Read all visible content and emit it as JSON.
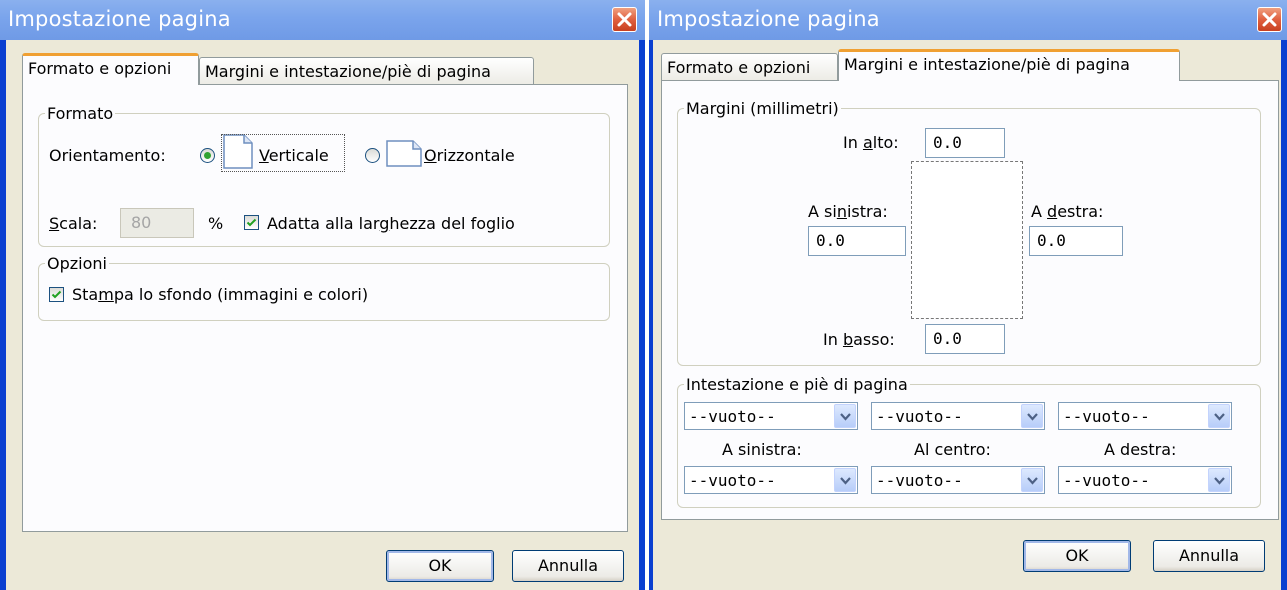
{
  "dialog_title": "Impostazione pagina",
  "tabs": {
    "format": "Formato e opzioni",
    "margins": "Margini e intestazione/piè di pagina"
  },
  "format_tab": {
    "format_group": "Formato",
    "orientation_label": "Orientamento:",
    "portrait": {
      "pre": "",
      "key": "V",
      "post": "erticale",
      "selected": true
    },
    "landscape": {
      "pre": "",
      "key": "O",
      "post": "rizzontale",
      "selected": false
    },
    "scale": {
      "pre": "",
      "key": "S",
      "post": "cala:",
      "value": "80",
      "unit": "%"
    },
    "shrink_to_fit": {
      "pre": "Adatta alla lar",
      "key": "g",
      "post": "hezza del foglio",
      "checked": true
    },
    "options_group": "Opzioni",
    "print_background": {
      "pre": "Sta",
      "key": "m",
      "post": "pa lo sfondo (immagini e colori)",
      "checked": true
    }
  },
  "margins_tab": {
    "margins_group": "Margini (millimetri)",
    "top": {
      "pre": "In ",
      "key": "a",
      "post": "lto:",
      "value": "0.0"
    },
    "left": {
      "pre": "A si",
      "key": "n",
      "post": "istra:",
      "value": "0.0"
    },
    "right": {
      "pre": "A ",
      "key": "d",
      "post": "estra:",
      "value": "0.0"
    },
    "bottom": {
      "pre": "In ",
      "key": "b",
      "post": "asso:",
      "value": "0.0"
    },
    "header_footer_group": "Intestazione e piè di pagina",
    "header_selects": [
      "--vuoto--",
      "--vuoto--",
      "--vuoto--"
    ],
    "position_labels": [
      "A sinistra:",
      "Al centro:",
      "A destra:"
    ],
    "footer_selects": [
      "--vuoto--",
      "--vuoto--",
      "--vuoto--"
    ]
  },
  "buttons": {
    "ok": "OK",
    "cancel": "Annulla"
  },
  "colors": {
    "titlebar": "#7aa4ec",
    "frame": "#0a3fd0",
    "dialog_bg": "#ece9d8",
    "close": "#e06040",
    "active_tab_accent": "#f0a032"
  }
}
